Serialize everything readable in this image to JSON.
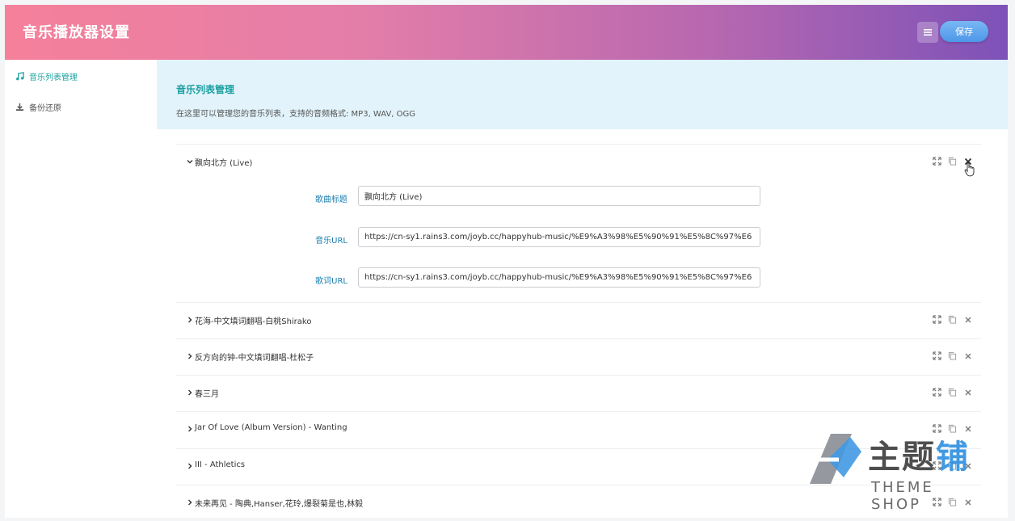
{
  "header": {
    "title": "音乐播放器设置",
    "menu_icon": "list-icon",
    "save_label": "保存"
  },
  "sidebar": {
    "items": [
      {
        "label": "音乐列表管理",
        "icon": "music-note-icon",
        "active": true
      },
      {
        "label": "备份还原",
        "icon": "download-icon",
        "active": false
      }
    ]
  },
  "main": {
    "section_title": "音乐列表管理",
    "section_desc": "在这里可以管理您的音乐列表，支持的音频格式: MP3, WAV, OGG",
    "songs": [
      {
        "title": "飘向北方 (Live)",
        "expanded": true
      },
      {
        "title": "花海-中文填词翻唱-白桃Shirako",
        "expanded": false
      },
      {
        "title": "反方向的钟-中文填词翻唱-杜松子",
        "expanded": false
      },
      {
        "title": "春三月",
        "expanded": false
      },
      {
        "title": "Jar Of Love (Album Version) - Wanting",
        "expanded": false
      },
      {
        "title": "III - Athletics",
        "expanded": false
      },
      {
        "title": "未来再见 - 陶典,Hanser,花玲,爆裂菊是也,林毅",
        "expanded": false
      }
    ],
    "form": {
      "title_label": "歌曲标题",
      "title_value": "飘向北方 (Live)",
      "url_label": "音乐URL",
      "url_value": "https://cn-sy1.rains3.com/joyb.cc/happyhub-music/%E9%A3%98%E5%90%91%E5%8C%97%E6",
      "lrc_label": "歌词URL",
      "lrc_value": "https://cn-sy1.rains3.com/joyb.cc/happyhub-music/%E9%A3%98%E5%90%91%E5%8C%97%E6"
    }
  },
  "watermark": {
    "brand_main": "主题",
    "brand_accent": "铺",
    "brand_sub": "THEME SHOP"
  },
  "colors": {
    "accent": "#1aa3a0",
    "header_start": "#f5809a",
    "header_end": "#7d52b8",
    "save_button": "#4e97e8"
  }
}
